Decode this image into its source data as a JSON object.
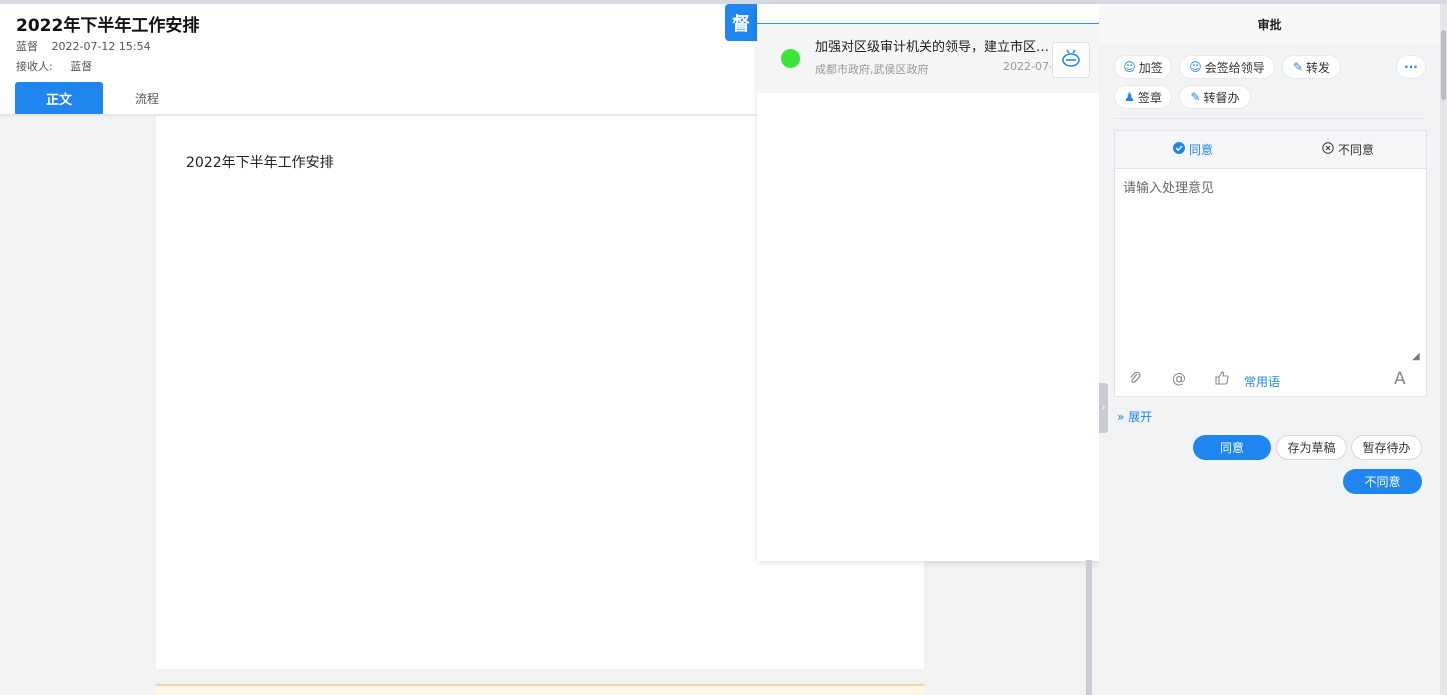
{
  "header": {
    "title": "2022年下半年工作安排",
    "author": "蓝督",
    "datetime": "2022-07-12 15:54",
    "receiver_label": "接收人:",
    "receiver": "蓝督",
    "tabs": [
      {
        "label": "正文",
        "active": true
      },
      {
        "label": "流程",
        "active": false
      }
    ]
  },
  "document": {
    "body_text": "2022年下半年工作安排"
  },
  "supervise": {
    "badge": "督",
    "item": {
      "title": "加强对区级审计机关的领导，建立市区…",
      "org": "成都市政府,武侯区政府",
      "date": "2022-07-",
      "status_color": "#3be33b"
    },
    "robot_icon": "robot-icon"
  },
  "approval": {
    "title": "审批",
    "actions": [
      {
        "label": "加签",
        "icon": "add-sign-icon"
      },
      {
        "label": "会签给领导",
        "icon": "countersign-icon"
      },
      {
        "label": "转发",
        "icon": "forward-icon"
      },
      {
        "label": "签章",
        "icon": "seal-icon"
      },
      {
        "label": "转督办",
        "icon": "supervise-transfer-icon"
      }
    ],
    "more": "···",
    "opinion_tabs": {
      "agree": "同意",
      "disagree": "不同意"
    },
    "opinion_placeholder": "请输入处理意见",
    "tools": {
      "attach_icon": "paperclip-icon",
      "mention": "@",
      "like_icon": "thumbs-up-icon",
      "phrases": "常用语",
      "font": "A"
    },
    "expand": "展开",
    "buttons": {
      "agree": "同意",
      "save_draft": "存为草稿",
      "hold": "暂存待办",
      "disagree": "不同意"
    }
  },
  "colors": {
    "accent": "#1f86ef",
    "status_dot": "#3be33b"
  }
}
